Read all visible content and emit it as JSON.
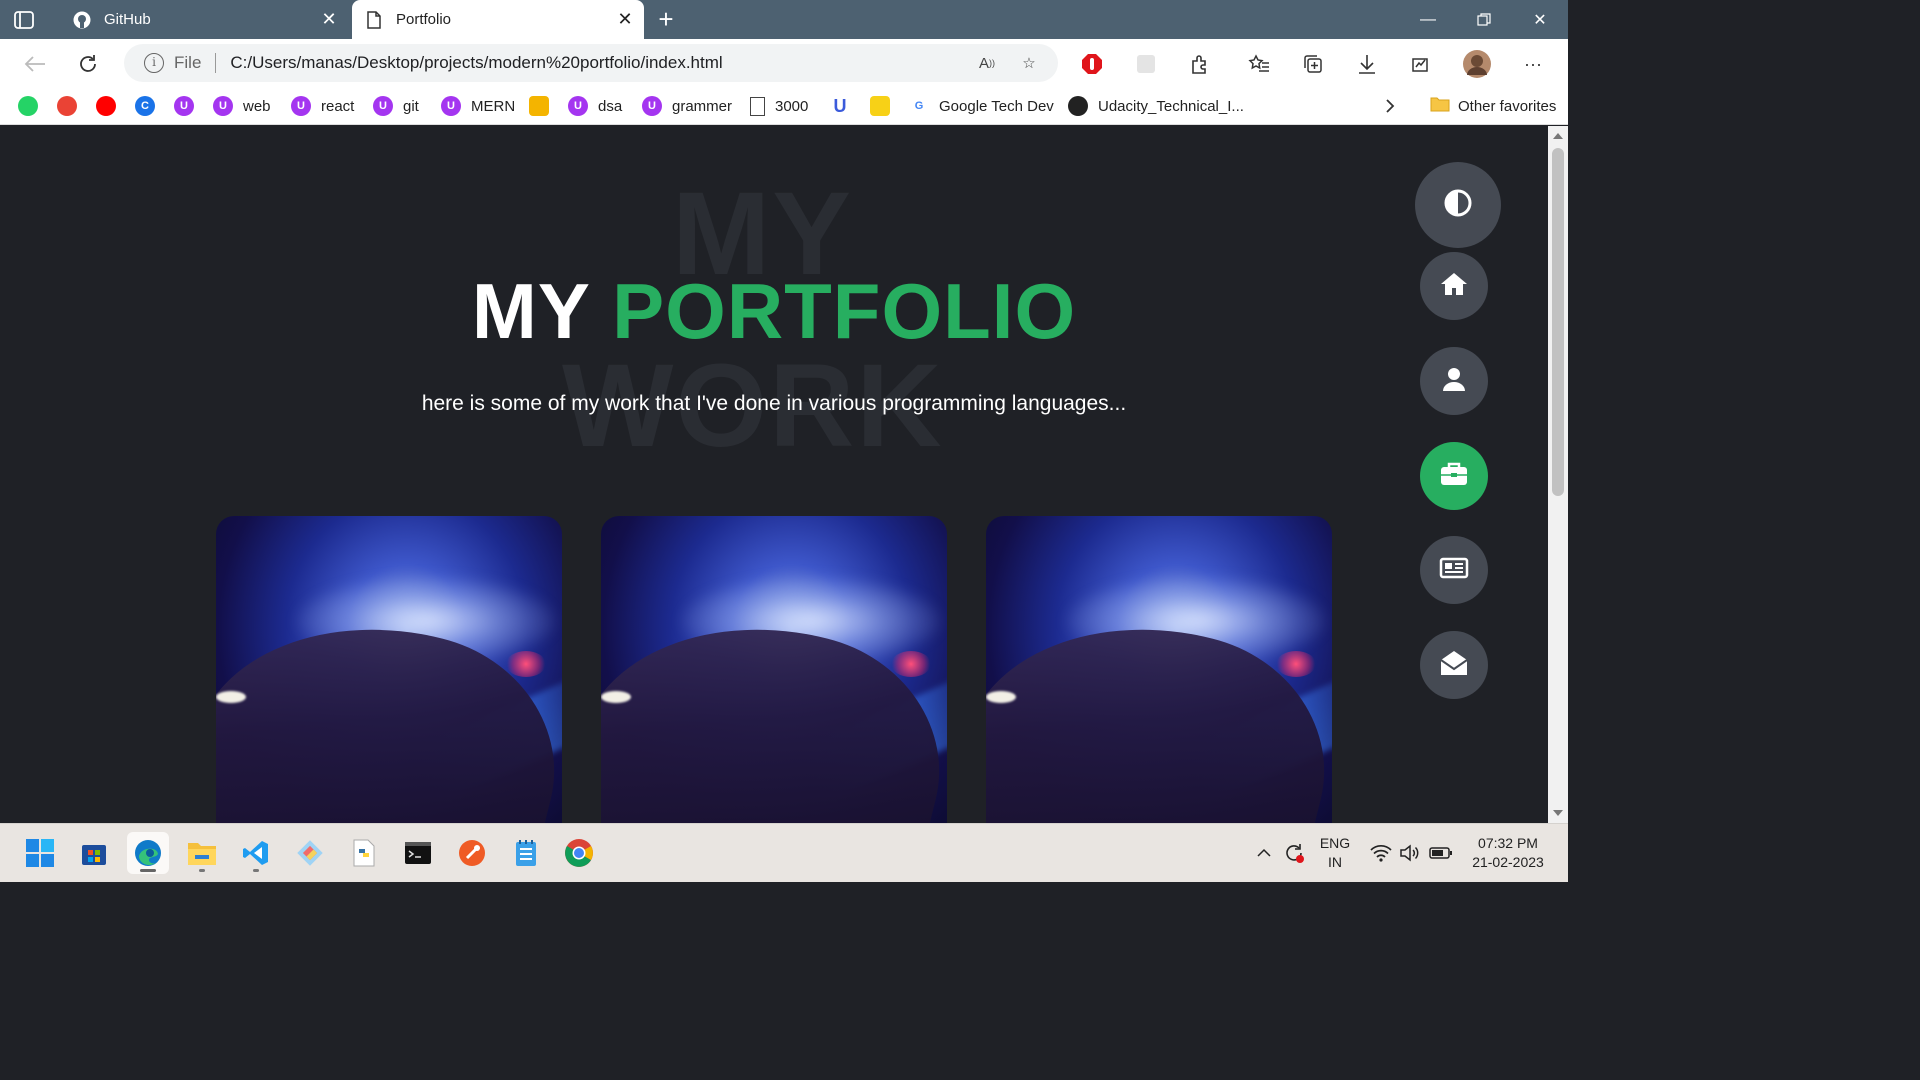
{
  "browser": {
    "tabs": [
      {
        "label": "GitHub",
        "icon": "github-icon"
      },
      {
        "label": "Portfolio",
        "icon": "page-icon"
      }
    ],
    "address": {
      "scheme_label": "File",
      "url": "C:/Users/manas/Desktop/projects/modern%20portfolio/index.html"
    },
    "favorites": [
      {
        "label": "",
        "icon": "whatsapp-icon",
        "color": "#25d366"
      },
      {
        "label": "",
        "icon": "gmail-icon",
        "color": "#ea4335"
      },
      {
        "label": "",
        "icon": "youtube-icon",
        "color": "#ff0000"
      },
      {
        "label": "",
        "icon": "c-icon",
        "color": "#1a73e8"
      },
      {
        "label": "",
        "icon": "udemy-icon",
        "color": "#a435f0"
      },
      {
        "label": "web",
        "icon": "udemy-icon",
        "color": "#a435f0"
      },
      {
        "label": "react",
        "icon": "udemy-icon",
        "color": "#a435f0"
      },
      {
        "label": "git",
        "icon": "udemy-icon",
        "color": "#a435f0"
      },
      {
        "label": "MERN",
        "icon": "udemy-icon",
        "color": "#a435f0"
      },
      {
        "label": "",
        "icon": "bulb-icon",
        "color": "#f4b400"
      },
      {
        "label": "dsa",
        "icon": "udemy-icon",
        "color": "#a435f0"
      },
      {
        "label": "grammer",
        "icon": "udemy-icon",
        "color": "#a435f0"
      },
      {
        "label": "3000",
        "icon": "page-icon",
        "color": "#444444"
      },
      {
        "label": "",
        "icon": "udacity-icon",
        "color": "#3b5bdb"
      },
      {
        "label": "",
        "icon": "flipkart-icon",
        "color": "#f7d117"
      },
      {
        "label": "Google Tech Dev",
        "icon": "google-icon",
        "color": "#4285f4"
      },
      {
        "label": "Udacity_Technical_I...",
        "icon": "github-icon",
        "color": "#222222"
      }
    ],
    "other_favorites": "Other favorites"
  },
  "page": {
    "bg_word_1": "MY",
    "bg_word_2": "WORK",
    "title_part1": "MY",
    "title_part2": "PORTFOLIO",
    "subtitle": "here is some of my work that I've done in various programming languages...",
    "accent_color": "#27ae60",
    "background_color": "#1f2126",
    "side_nav": [
      {
        "icon": "theme-toggle-icon",
        "active": false
      },
      {
        "icon": "home-icon",
        "active": false
      },
      {
        "icon": "user-icon",
        "active": false
      },
      {
        "icon": "briefcase-icon",
        "active": true
      },
      {
        "icon": "newspaper-icon",
        "active": false
      },
      {
        "icon": "envelope-open-icon",
        "active": false
      }
    ],
    "cards": [
      {
        "image": "keyboard-hand-image"
      },
      {
        "image": "keyboard-hand-image"
      },
      {
        "image": "keyboard-hand-image"
      }
    ]
  },
  "taskbar": {
    "apps": [
      "windows-start-icon",
      "microsoft-store-icon",
      "edge-icon",
      "file-explorer-icon",
      "vscode-icon",
      "git-icon",
      "python-icon",
      "terminal-icon",
      "postman-icon",
      "notepad-icon",
      "chrome-icon"
    ],
    "lang_1": "ENG",
    "lang_2": "IN",
    "time": "07:32 PM",
    "date": "21-02-2023"
  }
}
